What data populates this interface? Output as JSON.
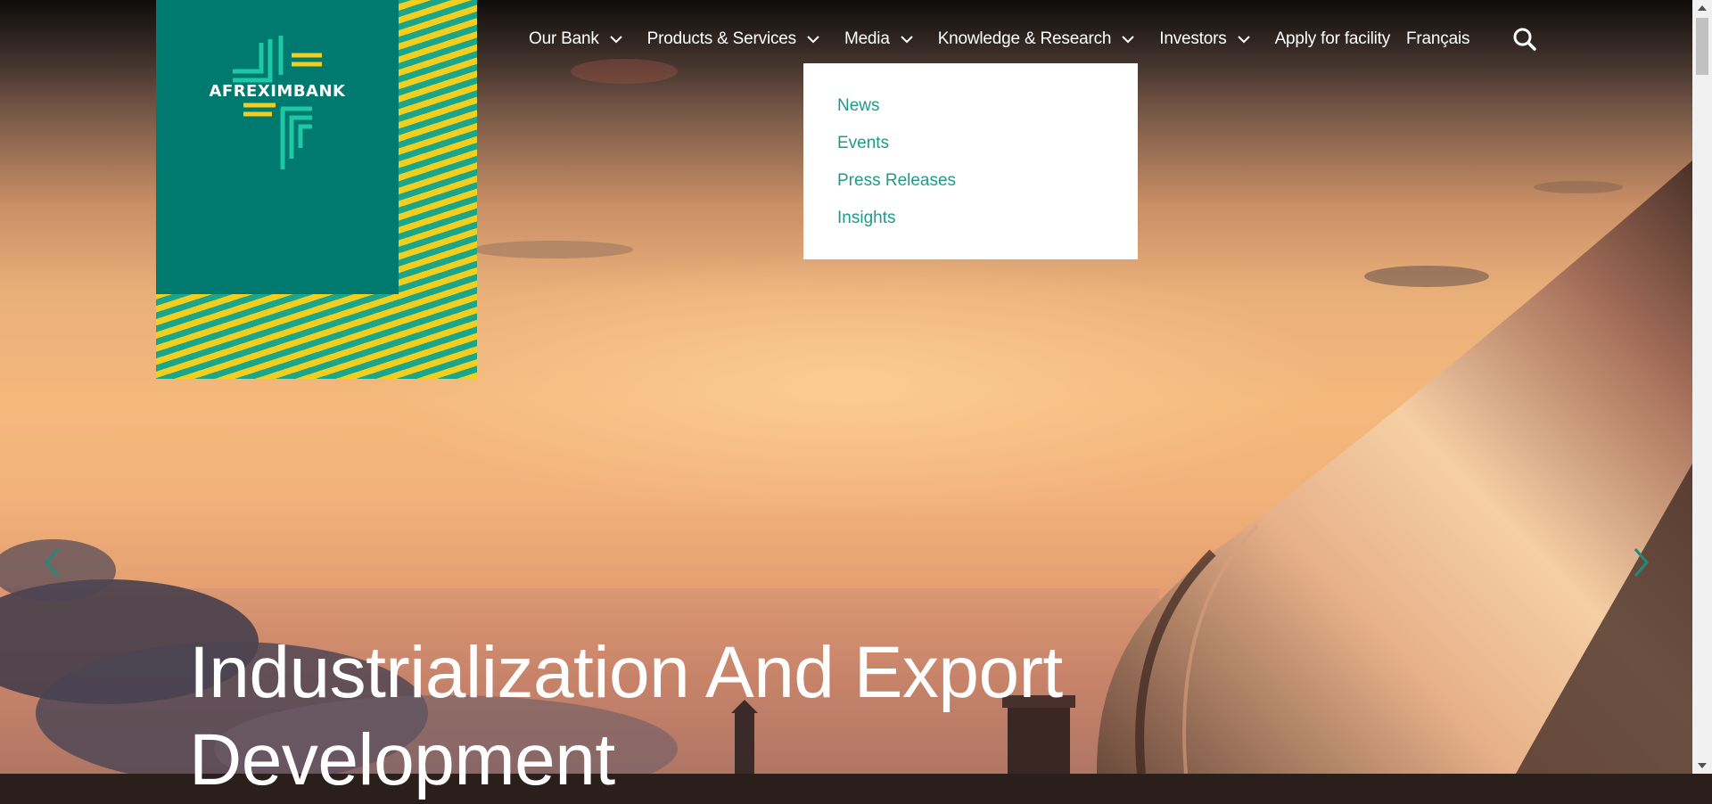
{
  "brand": {
    "name": "AFREXIMBANK",
    "colors": {
      "primary": "#007a6e",
      "accent_yellow": "#f2cf1f",
      "accent_green": "#1ba68b",
      "link": "#1f9a86"
    }
  },
  "nav": {
    "items": [
      {
        "label": "Our Bank",
        "has_dropdown": true
      },
      {
        "label": "Products & Services",
        "has_dropdown": true
      },
      {
        "label": "Media",
        "has_dropdown": true
      },
      {
        "label": "Knowledge & Research",
        "has_dropdown": true
      },
      {
        "label": "Investors",
        "has_dropdown": true
      },
      {
        "label": "Apply for facility",
        "has_dropdown": false
      },
      {
        "label": "Français",
        "has_dropdown": false
      }
    ],
    "search_icon": "search-icon"
  },
  "dropdown": {
    "parent": "Media",
    "items": [
      "News",
      "Events",
      "Press Releases",
      "Insights"
    ]
  },
  "hero": {
    "headline": "Industrialization And Export Development",
    "prev_icon": "chevron-left-icon",
    "next_icon": "chevron-right-icon"
  }
}
